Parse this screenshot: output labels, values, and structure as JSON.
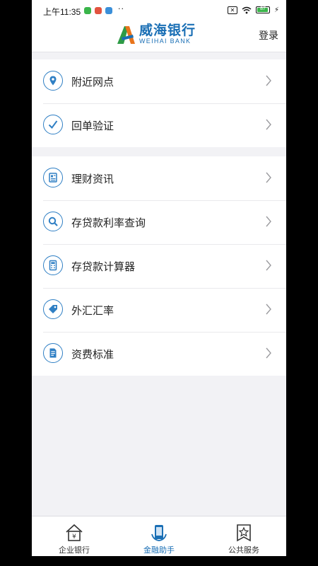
{
  "status_bar": {
    "time": "上午11:35",
    "dots": "··",
    "battery": "87",
    "battery_level": 0.87
  },
  "header": {
    "logo_cn": "威海银行",
    "logo_en": "WEIHAI BANK",
    "login_label": "登录"
  },
  "groups": [
    {
      "items": [
        {
          "label": "附近网点",
          "icon": "location-pin-icon"
        },
        {
          "label": "回单验证",
          "icon": "checkmark-icon"
        }
      ]
    },
    {
      "items": [
        {
          "label": "理财资讯",
          "icon": "news-icon"
        },
        {
          "label": "存贷款利率查询",
          "icon": "search-icon"
        },
        {
          "label": "存贷款计算器",
          "icon": "calculator-icon"
        },
        {
          "label": "外汇汇率",
          "icon": "tag-icon"
        },
        {
          "label": "资费标准",
          "icon": "document-icon"
        }
      ]
    }
  ],
  "tabbar": {
    "tabs": [
      {
        "label": "企业银行",
        "icon": "house-yen-icon",
        "active": false
      },
      {
        "label": "金融助手",
        "icon": "phone-assistant-icon",
        "active": true
      },
      {
        "label": "公共服务",
        "icon": "star-bookmark-icon",
        "active": false
      }
    ]
  },
  "colors": {
    "accent": "#2f7fc4",
    "brand": "#1a6fb5",
    "logo_orange": "#e8741b",
    "logo_green": "#2e9b46"
  }
}
